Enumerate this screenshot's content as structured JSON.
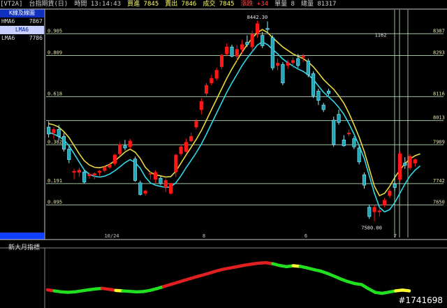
{
  "topbar": {
    "items": [
      {
        "label": "[VT2A]",
        "color": "#cccccc"
      },
      {
        "label": "台指期貨(日)",
        "color": "#cccccc"
      },
      {
        "label": "時間 13:14:43",
        "color": "#cccccc"
      },
      {
        "label": "買進 7845",
        "color": "#ffff66"
      },
      {
        "label": "賣出 7846",
        "color": "#ffff66"
      },
      {
        "label": "成交 7845",
        "color": "#ffff66"
      },
      {
        "label": "漲跌 +34",
        "color": "#ff4444"
      },
      {
        "label": "單量 8",
        "color": "#cccccc"
      },
      {
        "label": "總量 81317",
        "color": "#cccccc"
      }
    ]
  },
  "left_panel": {
    "header": "K線及線圖",
    "hma_label": "HMA6",
    "hma_value": "7867",
    "selected": "LMA6",
    "lma_label": "LMA6",
    "lma_value": "7786"
  },
  "subchart": {
    "title": "新大月指標"
  },
  "watermark": "#1741698",
  "chart_data": {
    "type": "candlestick",
    "price_range": [
      7510,
      8490
    ],
    "high_label": "8442.30",
    "low_label": "7580.00",
    "fib_lines": [
      {
        "ratio": "0.905",
        "price": "8387"
      },
      {
        "ratio": "0.809",
        "price": "8293"
      },
      {
        "ratio": "0.618",
        "price": "8116"
      },
      {
        "ratio": "",
        "price": "8013"
      },
      {
        "ratio": "0.382",
        "price": "7909"
      },
      {
        "ratio": "0.191",
        "price": "7742"
      },
      {
        "ratio": "0.095",
        "price": "7650"
      }
    ],
    "annotation": "1162",
    "x_labels": [
      "10/24",
      "8",
      "6",
      "7"
    ],
    "candles": [
      {
        "o": 7985,
        "h": 8010,
        "l": 7940,
        "c": 7955
      },
      {
        "o": 7960,
        "h": 7985,
        "l": 7935,
        "c": 7975
      },
      {
        "o": 7975,
        "h": 7995,
        "l": 7930,
        "c": 7945
      },
      {
        "o": 7945,
        "h": 7960,
        "l": 7880,
        "c": 7890
      },
      {
        "o": 7890,
        "h": 7905,
        "l": 7830,
        "c": 7845
      },
      {
        "o": 7790,
        "h": 7805,
        "l": 7760,
        "c": 7795
      },
      {
        "o": 7790,
        "h": 7810,
        "l": 7770,
        "c": 7800
      },
      {
        "o": 7792,
        "h": 7800,
        "l": 7742,
        "c": 7748
      },
      {
        "o": 7775,
        "h": 7790,
        "l": 7765,
        "c": 7782
      },
      {
        "o": 7778,
        "h": 7790,
        "l": 7760,
        "c": 7785
      },
      {
        "o": 7790,
        "h": 7800,
        "l": 7775,
        "c": 7795
      },
      {
        "o": 7798,
        "h": 7820,
        "l": 7790,
        "c": 7812
      },
      {
        "o": 7812,
        "h": 7830,
        "l": 7805,
        "c": 7822
      },
      {
        "o": 7828,
        "h": 7870,
        "l": 7820,
        "c": 7865
      },
      {
        "o": 7870,
        "h": 7920,
        "l": 7862,
        "c": 7910
      },
      {
        "o": 7905,
        "h": 7930,
        "l": 7885,
        "c": 7895
      },
      {
        "o": 7900,
        "h": 7935,
        "l": 7890,
        "c": 7925
      },
      {
        "o": 7848,
        "h": 7858,
        "l": 7750,
        "c": 7755
      },
      {
        "o": 7745,
        "h": 7755,
        "l": 7690,
        "c": 7695
      },
      {
        "o": 7700,
        "h": 7716,
        "l": 7690,
        "c": 7710
      },
      {
        "o": 7785,
        "h": 7795,
        "l": 7760,
        "c": 7785
      },
      {
        "o": 7760,
        "h": 7800,
        "l": 7745,
        "c": 7790
      },
      {
        "o": 7765,
        "h": 7775,
        "l": 7735,
        "c": 7742
      },
      {
        "o": 7725,
        "h": 7765,
        "l": 7705,
        "c": 7755
      },
      {
        "o": 7700,
        "h": 7745,
        "l": 7695,
        "c": 7742
      },
      {
        "o": 7792,
        "h": 7870,
        "l": 7770,
        "c": 7865
      },
      {
        "o": 7870,
        "h": 7910,
        "l": 7860,
        "c": 7900
      },
      {
        "o": 7880,
        "h": 7935,
        "l": 7875,
        "c": 7920
      },
      {
        "o": 7925,
        "h": 7960,
        "l": 7920,
        "c": 7945
      },
      {
        "o": 7985,
        "h": 8020,
        "l": 7975,
        "c": 8010
      },
      {
        "o": 8060,
        "h": 8110,
        "l": 8040,
        "c": 8095
      },
      {
        "o": 8130,
        "h": 8175,
        "l": 8120,
        "c": 8165
      },
      {
        "o": 8175,
        "h": 8210,
        "l": 8165,
        "c": 8195
      },
      {
        "o": 8195,
        "h": 8240,
        "l": 8185,
        "c": 8230
      },
      {
        "o": 8245,
        "h": 8300,
        "l": 8235,
        "c": 8295
      },
      {
        "o": 8300,
        "h": 8345,
        "l": 8290,
        "c": 8330
      },
      {
        "o": 8330,
        "h": 8340,
        "l": 8285,
        "c": 8290
      },
      {
        "o": 8290,
        "h": 8340,
        "l": 8270,
        "c": 8320
      },
      {
        "o": 8320,
        "h": 8360,
        "l": 8300,
        "c": 8340
      },
      {
        "o": 8350,
        "h": 8380,
        "l": 8330,
        "c": 8340
      },
      {
        "o": 8330,
        "h": 8400,
        "l": 8310,
        "c": 8385
      },
      {
        "o": 8390,
        "h": 8442,
        "l": 8370,
        "c": 8430
      },
      {
        "o": 8380,
        "h": 8395,
        "l": 8325,
        "c": 8335
      },
      {
        "o": 8410,
        "h": 8440,
        "l": 8390,
        "c": 8405
      },
      {
        "o": 8370,
        "h": 8380,
        "l": 8230,
        "c": 8240
      },
      {
        "o": 8250,
        "h": 8280,
        "l": 8230,
        "c": 8260
      },
      {
        "o": 8255,
        "h": 8265,
        "l": 8165,
        "c": 8175
      },
      {
        "o": 8250,
        "h": 8275,
        "l": 8235,
        "c": 8262
      },
      {
        "o": 8262,
        "h": 8285,
        "l": 8240,
        "c": 8272
      },
      {
        "o": 8280,
        "h": 8300,
        "l": 8240,
        "c": 8250
      },
      {
        "o": 8285,
        "h": 8300,
        "l": 8265,
        "c": 8290
      },
      {
        "o": 8270,
        "h": 8280,
        "l": 8200,
        "c": 8210
      },
      {
        "o": 8215,
        "h": 8225,
        "l": 8110,
        "c": 8120
      },
      {
        "o": 8140,
        "h": 8150,
        "l": 8080,
        "c": 8100
      },
      {
        "o": 8080,
        "h": 8090,
        "l": 8050,
        "c": 8060
      },
      {
        "o": 8140,
        "h": 8150,
        "l": 8120,
        "c": 8130
      },
      {
        "o": 8015,
        "h": 8030,
        "l": 7900,
        "c": 7910
      },
      {
        "o": 8040,
        "h": 8060,
        "l": 7995,
        "c": 8005
      },
      {
        "o": 7930,
        "h": 7950,
        "l": 7900,
        "c": 7905
      },
      {
        "o": 7955,
        "h": 7975,
        "l": 7945,
        "c": 7960
      },
      {
        "o": 7935,
        "h": 7945,
        "l": 7890,
        "c": 7900
      },
      {
        "o": 7895,
        "h": 7905,
        "l": 7825,
        "c": 7835
      },
      {
        "o": 7780,
        "h": 7790,
        "l": 7720,
        "c": 7735
      },
      {
        "o": 7640,
        "h": 7650,
        "l": 7590,
        "c": 7600
      },
      {
        "o": 7620,
        "h": 7650,
        "l": 7580,
        "c": 7640
      },
      {
        "o": 7620,
        "h": 7640,
        "l": 7600,
        "c": 7625
      },
      {
        "o": 7650,
        "h": 7680,
        "l": 7640,
        "c": 7670
      },
      {
        "o": 7690,
        "h": 7720,
        "l": 7680,
        "c": 7710
      },
      {
        "o": 7740,
        "h": 7780,
        "l": 7710,
        "c": 7725
      },
      {
        "o": 7760,
        "h": 7880,
        "l": 7750,
        "c": 7870
      },
      {
        "o": 7830,
        "h": 7855,
        "l": 7805,
        "c": 7820
      },
      {
        "o": 7810,
        "h": 7870,
        "l": 7800,
        "c": 7860
      },
      {
        "o": 7830,
        "h": 7850,
        "l": 7815,
        "c": 7845
      }
    ],
    "lma": [
      7962,
      7955,
      7945,
      7930,
      7905,
      7870,
      7835,
      7800,
      7782,
      7773,
      7770,
      7774,
      7783,
      7797,
      7814,
      7832,
      7845,
      7833,
      7808,
      7770,
      7745,
      7735,
      7730,
      7725,
      7728,
      7745,
      7775,
      7810,
      7842,
      7875,
      7912,
      7955,
      8000,
      8045,
      8090,
      8135,
      8175,
      8212,
      8250,
      8282,
      8310,
      8338,
      8352,
      8340,
      8320,
      8300,
      8278,
      8262,
      8248,
      8235,
      8225,
      8210,
      8190,
      8162,
      8135,
      8115,
      8095,
      8070,
      8040,
      8000,
      7955,
      7905,
      7850,
      7775,
      7700,
      7640,
      7620,
      7630,
      7660,
      7700,
      7740,
      7775,
      7800,
      7818
    ],
    "hma": [
      8000,
      7995,
      7985,
      7965,
      7940,
      7905,
      7870,
      7840,
      7822,
      7812,
      7810,
      7815,
      7825,
      7840,
      7858,
      7878,
      7890,
      7877,
      7850,
      7812,
      7790,
      7780,
      7775,
      7770,
      7772,
      7795,
      7830,
      7865,
      7898,
      7932,
      7970,
      8015,
      8060,
      8105,
      8150,
      8195,
      8235,
      8272,
      8308,
      8340,
      8368,
      8392,
      8405,
      8392,
      8370,
      8350,
      8330,
      8315,
      8300,
      8290,
      8280,
      8265,
      8245,
      8218,
      8190,
      8168,
      8148,
      8120,
      8088,
      8045,
      7995,
      7942,
      7880,
      7805,
      7730,
      7690,
      7700,
      7730,
      7768,
      7800,
      7828,
      7848,
      7862,
      7870
    ],
    "indicator": {
      "values": [
        0.62,
        0.55,
        0.48,
        0.45,
        0.48,
        0.55,
        0.62,
        0.68,
        0.72,
        0.66,
        0.58,
        0.55,
        0.52,
        0.48,
        0.5,
        0.58,
        0.7,
        0.84,
        0.98,
        1.12,
        1.26,
        1.4,
        1.54,
        1.66,
        1.8,
        1.94,
        2.05,
        2.13,
        2.22,
        2.31,
        2.38,
        2.44,
        2.47,
        2.4,
        2.28,
        2.2,
        2.26,
        2.22,
        2.12,
        2.0,
        1.9,
        1.74,
        1.55,
        1.35,
        1.18,
        1.05,
        0.98,
        0.7,
        0.45,
        0.38,
        0.46,
        0.55,
        0.6,
        0.55
      ],
      "colors": [
        "#e02020",
        "#20e020",
        "#20e020",
        "#20e020",
        "#20e020",
        "#20e020",
        "#20e020",
        "#20e020",
        "#e02020",
        "#e02020",
        "#ffff30",
        "#20e020",
        "#20e020",
        "#20e020",
        "#20e020",
        "#20e020",
        "#20e020",
        "#e02020",
        "#e02020",
        "#e02020",
        "#e02020",
        "#e02020",
        "#e02020",
        "#e02020",
        "#e02020",
        "#e02020",
        "#e02020",
        "#e02020",
        "#e02020",
        "#e02020",
        "#e02020",
        "#e02020",
        "#e02020",
        "#20e020",
        "#20e020",
        "#20e020",
        "#ffff30",
        "#20e020",
        "#20e020",
        "#20e020",
        "#20e020",
        "#20e020",
        "#20e020",
        "#20e020",
        "#20e020",
        "#20e020",
        "#20e020",
        "#20e020",
        "#20e020",
        "#20e020",
        "#20e020",
        "#ffff30",
        "#ffff30",
        "#ffff30"
      ],
      "range": [
        0,
        3
      ]
    },
    "colors": {
      "up": "#ff1818",
      "down_fill": "#20a8b8",
      "down_edge": "#90f0ff",
      "lma": "#30d8e8",
      "hma": "#e8d840",
      "grid": "#c8f0c8",
      "fib": "#d8ffd8",
      "axis": "#c8c8c8"
    }
  }
}
